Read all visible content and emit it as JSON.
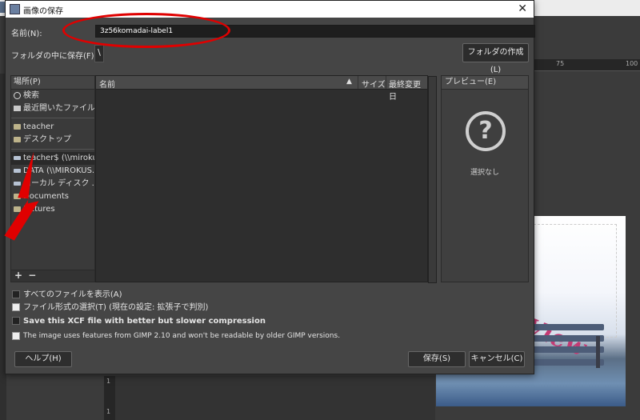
{
  "background": {
    "ruler_h_labels": [
      "75",
      "100"
    ],
    "ruler_v_labels": [
      "1",
      "1"
    ],
    "image_text": "e View"
  },
  "dialog": {
    "title": "画像の保存",
    "name_label": "名前(N):",
    "name_value": "3z56komadai-label1",
    "save_in_label": "フォルダの中に保存(F):",
    "path_button": "\\",
    "create_folder_button": "フォルダの作成(L)",
    "places": {
      "header": "場所(P)",
      "items": [
        {
          "label": "検索",
          "icon": "search-icon"
        },
        {
          "label": "最近開いたファイル",
          "icon": "recent-icon"
        },
        {
          "label": "teacher",
          "icon": "folder-icon"
        },
        {
          "label": "デスクトップ",
          "icon": "folder-icon"
        },
        {
          "label": "teacher$ (\\\\miroku...",
          "icon": "drive-icon"
        },
        {
          "label": "DATA (\\\\MIROKUS...",
          "icon": "drive-icon"
        },
        {
          "label": "ローカル ディスク ...",
          "icon": "drive-icon"
        },
        {
          "label": "Documents",
          "icon": "folder-icon"
        },
        {
          "label": "Pictures",
          "icon": "folder-icon"
        }
      ],
      "add_button": "+",
      "remove_button": "−"
    },
    "files": {
      "columns": {
        "name": "名前",
        "size": "サイズ",
        "modified": "最終変更日"
      }
    },
    "preview": {
      "header": "プレビュー(E)",
      "empty_text": "選択なし"
    },
    "options": {
      "show_all_files": "すべてのファイルを表示(A)",
      "file_type": "ファイル形式の選択(T) (現在の設定: 拡張子で判別)",
      "compression": "Save this XCF file with better but slower compression",
      "warning": "The image uses features from GIMP 2.10 and won't be readable by older GIMP versions."
    },
    "buttons": {
      "help": "ヘルプ(H)",
      "save": "保存(S)",
      "cancel": "キャンセル(C)"
    }
  },
  "colors": {
    "annotation_red": "#e00000",
    "dialog_bg": "#454545"
  }
}
